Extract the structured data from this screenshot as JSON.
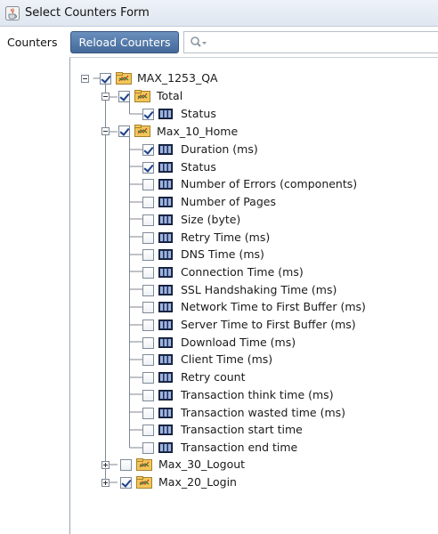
{
  "window": {
    "title": "Select Counters Form"
  },
  "left_label": "Counters",
  "toolbar": {
    "reload_label": "Reload Counters",
    "search_placeholder": ""
  },
  "tree": {
    "root": {
      "label": "MAX_1253_QA",
      "checked": true,
      "expanded": true
    },
    "total": {
      "label": "Total",
      "checked": true,
      "expanded": true
    },
    "total_status": {
      "label": "Status",
      "checked": true
    },
    "home": {
      "label": "Max_10_Home",
      "checked": true,
      "expanded": true
    },
    "counters": [
      {
        "label": "Duration (ms)",
        "checked": true
      },
      {
        "label": "Status",
        "checked": true
      },
      {
        "label": "Number of Errors (components)",
        "checked": false
      },
      {
        "label": "Number of Pages",
        "checked": false
      },
      {
        "label": "Size (byte)",
        "checked": false
      },
      {
        "label": "Retry Time (ms)",
        "checked": false
      },
      {
        "label": "DNS Time (ms)",
        "checked": false
      },
      {
        "label": "Connection Time (ms)",
        "checked": false
      },
      {
        "label": "SSL Handshaking Time (ms)",
        "checked": false
      },
      {
        "label": "Network Time to First Buffer (ms)",
        "checked": false
      },
      {
        "label": "Server Time to First Buffer (ms)",
        "checked": false
      },
      {
        "label": "Download Time (ms)",
        "checked": false
      },
      {
        "label": "Client Time (ms)",
        "checked": false
      },
      {
        "label": "Retry count",
        "checked": false
      },
      {
        "label": "Transaction think time (ms)",
        "checked": false
      },
      {
        "label": "Transaction wasted time (ms)",
        "checked": false
      },
      {
        "label": "Transaction start time",
        "checked": false
      },
      {
        "label": "Transaction end time",
        "checked": false
      }
    ],
    "logout": {
      "label": "Max_30_Logout",
      "checked": false,
      "expanded": false
    },
    "login": {
      "label": "Max_20_Login",
      "checked": true,
      "expanded": false
    }
  },
  "icons": {
    "title_icon": "java-cup-icon",
    "search": "search-dropdown-icon",
    "group": "folder-group-icon",
    "counter": "counter-icon"
  },
  "colors": {
    "button_top": "#6a90be",
    "button_bottom": "#44699a",
    "check_mark": "#1c3f8a",
    "folder": "#e8b84a"
  }
}
